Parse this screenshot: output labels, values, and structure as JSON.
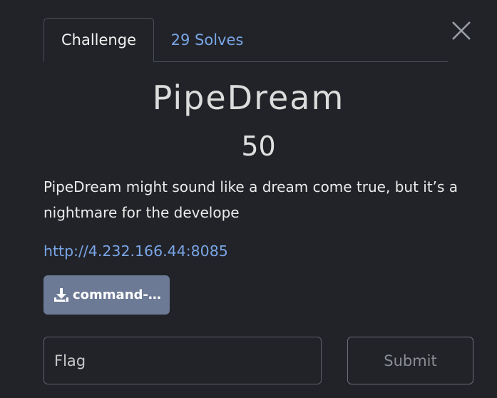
{
  "tabs": [
    {
      "label": "Challenge",
      "active": true
    },
    {
      "label": "29 Solves",
      "active": false
    }
  ],
  "challenge": {
    "name": "PipeDream",
    "points": "50",
    "description": "PipeDream might sound like a dream come true, but it’s a nightmare for the develope",
    "link": "http://4.232.166.44:8085",
    "file_label": "command-…"
  },
  "form": {
    "flag_placeholder": "Flag",
    "submit_label": "Submit"
  },
  "icons": {
    "close": "close-icon",
    "download": "download-icon"
  },
  "colors": {
    "background": "#212328",
    "link": "#7aa5e6",
    "file_button": "#6c7a96"
  }
}
